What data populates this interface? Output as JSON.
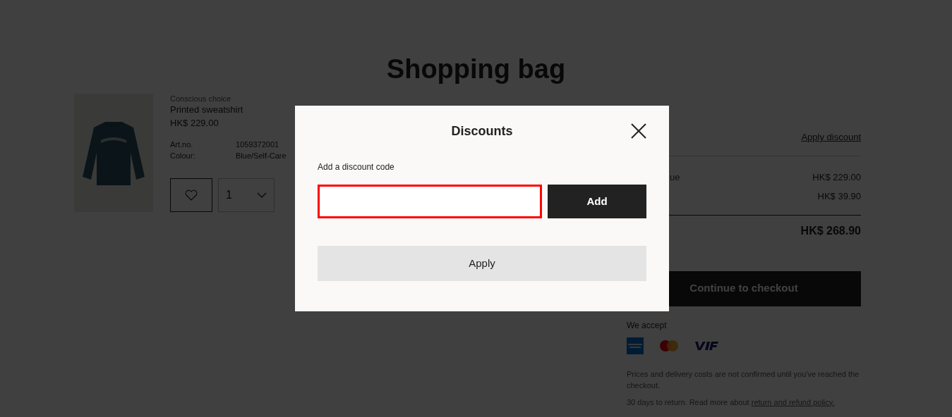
{
  "page": {
    "title": "Shopping bag"
  },
  "product": {
    "kind": "picture",
    "tag": "Conscious choice",
    "name": "Printed sweatshirt",
    "price": "HK$ 229.00",
    "details": [
      {
        "label": "Art.no.",
        "value": "1059372001"
      },
      {
        "label": "Colour:",
        "value": "Blue/Self-Care"
      }
    ],
    "quantity": "1"
  },
  "summary": {
    "discount_link": "Apply discount",
    "rows": [
      {
        "label": "ue",
        "value": "HK$ 229.00"
      },
      {
        "label": "",
        "value": "HK$ 39.90"
      }
    ],
    "total": "HK$ 268.90",
    "checkout_button": "Continue to checkout",
    "we_accept": "We accept",
    "note": "Prices and delivery costs are not confirmed until you've reached the checkout.",
    "returns_text": "30 days to return. Read more about ",
    "returns_link": "return and refund policy."
  },
  "dialog": {
    "title": "Discounts",
    "field_label": "Add a discount code",
    "field_error": true,
    "add_button": "Add",
    "apply_button": "Apply"
  }
}
